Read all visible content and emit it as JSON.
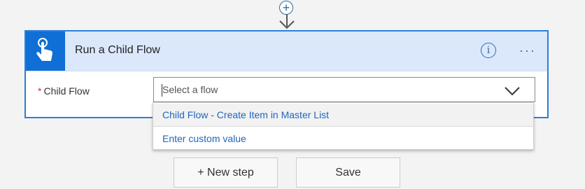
{
  "connector": {
    "insert_symbol": "+"
  },
  "card": {
    "title": "Run a Child Flow",
    "info_symbol": "i",
    "more_symbol": "···",
    "field": {
      "required_marker": "*",
      "label": "Child Flow",
      "placeholder": "Select a flow"
    }
  },
  "dropdown": {
    "items": [
      {
        "label": "Child Flow - Create Item in Master List"
      },
      {
        "label": "Enter custom value"
      }
    ]
  },
  "footer": {
    "new_step_label": "+ New step",
    "save_label": "Save"
  },
  "colors": {
    "accent": "#0f6fd6",
    "header_bg": "#dbe8fb",
    "link": "#1f66c1",
    "required": "#d13438"
  },
  "icons": {
    "trigger": "hand-tap-icon",
    "info": "info-icon",
    "more": "more-options-icon",
    "chevron": "chevron-down-icon",
    "insert": "plus-circle-icon",
    "arrow": "arrow-down-icon"
  }
}
